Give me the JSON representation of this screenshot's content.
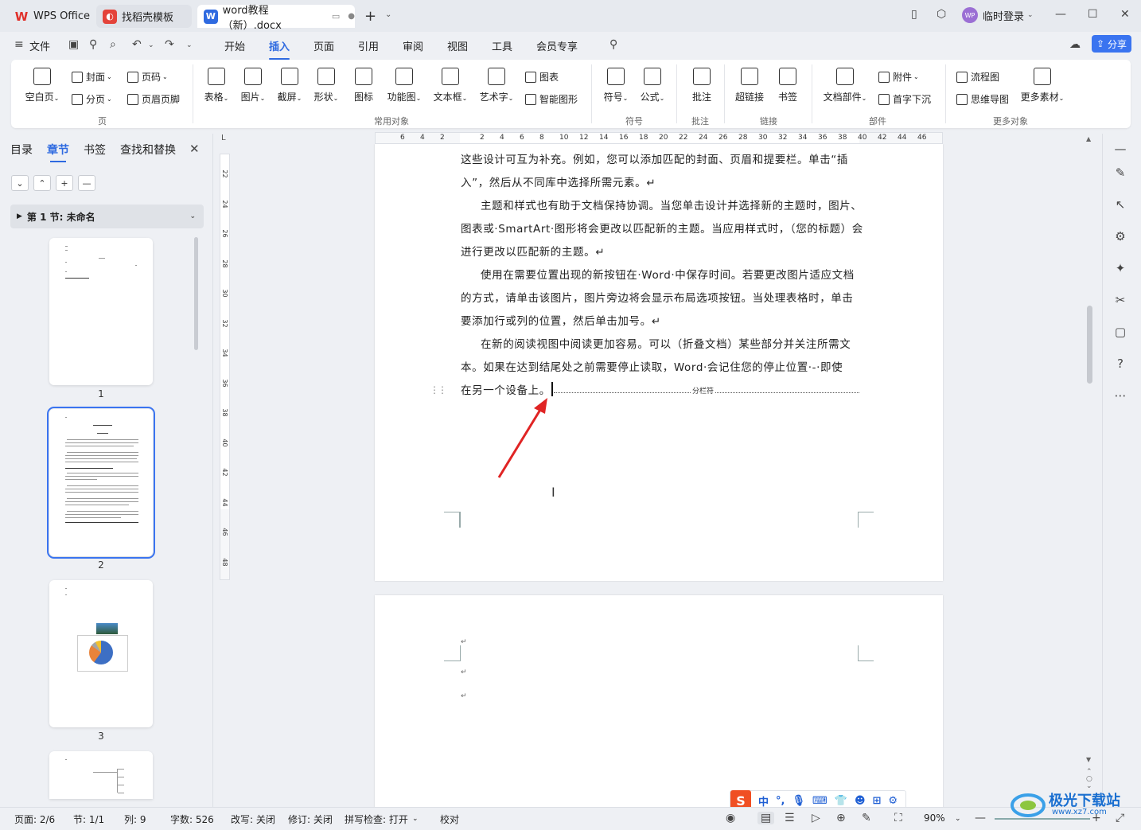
{
  "tabs": {
    "wps": "WPS Office",
    "template": "找稻壳模板",
    "doc": "word教程（新）.docx"
  },
  "window": {
    "login": "临时登录",
    "avatar_text": "WP"
  },
  "menu": {
    "file": "文件",
    "items": [
      "开始",
      "插入",
      "页面",
      "引用",
      "审阅",
      "视图",
      "工具",
      "会员专享"
    ],
    "active": "插入",
    "share": "分享"
  },
  "ribbon": {
    "page_group": {
      "blank_page": "空白页",
      "cover": "封面",
      "page_break": "分页",
      "page_number": "页码",
      "header_footer": "页眉页脚",
      "label": "页"
    },
    "objects_group": {
      "table": "表格",
      "picture": "图片",
      "screenshot": "截屏",
      "shape": "形状",
      "icon": "图标",
      "function_chart": "功能图",
      "textbox": "文本框",
      "wordart": "艺术字",
      "chart": "图表",
      "smart_shape": "智能图形",
      "label": "常用对象"
    },
    "symbol_group": {
      "symbol": "符号",
      "formula": "公式",
      "label": "符号"
    },
    "comment_group": {
      "comment": "批注",
      "label": "批注"
    },
    "link_group": {
      "hyperlink": "超链接",
      "bookmark": "书签",
      "label": "链接"
    },
    "parts_group": {
      "doc_parts": "文档部件",
      "attachment": "附件",
      "drop_cap": "首字下沉",
      "label": "部件"
    },
    "more_group": {
      "flowchart": "流程图",
      "mindmap": "思维导图",
      "more_material": "更多素材",
      "label": "更多对象"
    }
  },
  "left_panel": {
    "tabs": [
      "目录",
      "章节",
      "书签",
      "查找和替换"
    ],
    "active_tab": "章节",
    "section": "第 1 节: 未命名",
    "pages": [
      "1",
      "2",
      "3"
    ]
  },
  "ruler": {
    "h_ticks": [
      "6",
      "4",
      "2",
      "2",
      "4",
      "6",
      "8",
      "10",
      "12",
      "14",
      "16",
      "18",
      "20",
      "22",
      "24",
      "26",
      "28",
      "30",
      "32",
      "34",
      "36",
      "38",
      "40",
      "42",
      "44",
      "46"
    ],
    "v_ticks": [
      "22",
      "24",
      "26",
      "28",
      "30",
      "32",
      "34",
      "36",
      "38",
      "40",
      "42",
      "44",
      "46",
      "48"
    ]
  },
  "document": {
    "lines": [
      "这些设计可互为补充。例如，您可以添加匹配的封面、页眉和提要栏。单击“插",
      "入”，然后从不同库中选择所需元素。↵",
      "主题和样式也有助于文档保持协调。当您单击设计并选择新的主题时，图片、",
      "图表或·SmartArt·图形将会更改以匹配新的主题。当应用样式时，（您的标题）会",
      "进行更改以匹配新的主题。↵",
      "使用在需要位置出现的新按钮在·Word·中保存时间。若要更改图片适应文档",
      "的方式，请单击该图片，图片旁边将会显示布局选项按钮。当处理表格时，单击",
      "要添加行或列的位置，然后单击加号。↵",
      "在新的阅读视图中阅读更加容易。可以（折叠文档）某些部分并关注所需文",
      "本。如果在达到结尾处之前需要停止读取，Word·会记住您的停止位置·-·即使",
      "在另一个设备上。"
    ],
    "column_break_label": "分栏符",
    "para_mark": "↵"
  },
  "status": {
    "page": "页面: 2/6",
    "section": "节: 1/1",
    "column": "列: 9",
    "word_count": "字数: 526",
    "overtype": "改写: 关闭",
    "revision": "修订: 关闭",
    "spell": "拼写检查: 打开",
    "proofread": "校对",
    "zoom": "90%"
  },
  "ime": {
    "label": "中"
  },
  "watermark": {
    "text": "极光下载站",
    "url": "www.xz7.com"
  },
  "colors": {
    "accent": "#2f6ae0",
    "share": "#3a74f0",
    "arrow": "#e02424"
  }
}
